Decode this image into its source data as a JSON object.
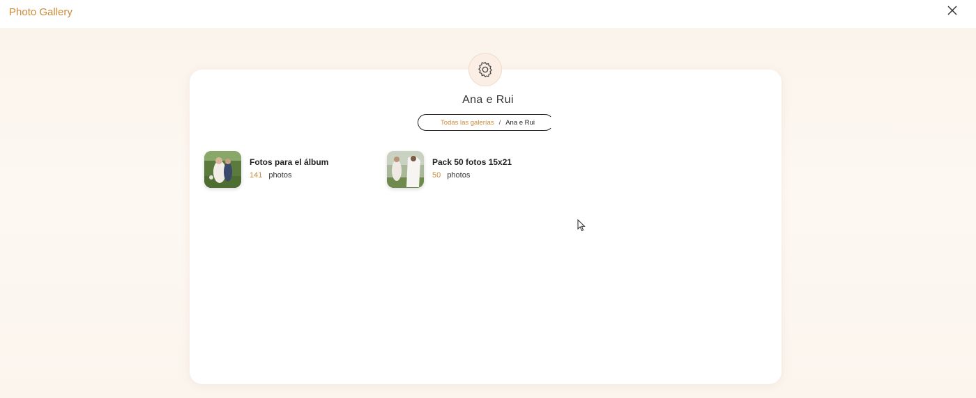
{
  "app": {
    "title": "Photo Gallery"
  },
  "gallery": {
    "title": "Ana e Rui",
    "breadcrumb": {
      "root": "Todas las galerías",
      "separator": "/",
      "current": "Ana e Rui"
    }
  },
  "albums": [
    {
      "name": "Fotos para el álbum",
      "count": "141",
      "unit": "photos"
    },
    {
      "name": "Pack 50 fotos 15x21",
      "count": "50",
      "unit": "photos"
    }
  ],
  "icons": {
    "close": "close-icon",
    "settings": "gear-icon",
    "cursor": "mouse-pointer-icon"
  },
  "colors": {
    "accent": "#c98a3a",
    "background": "#fbf4ec",
    "card": "#ffffff"
  }
}
